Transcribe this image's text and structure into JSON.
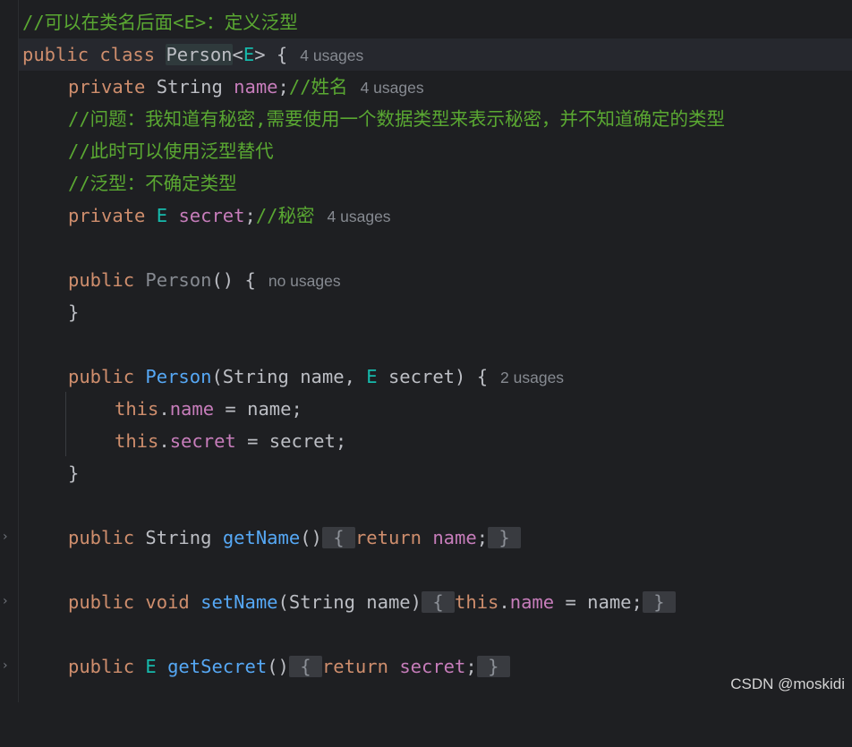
{
  "editor": {
    "l1": {
      "comment": "//可以在类名后面<E>：定义泛型"
    },
    "l2": {
      "kw_public": "public",
      "kw_class": "class",
      "class_name": "Person",
      "lt": "<",
      "type_param": "E",
      "gt_brace": "> {",
      "hint": "4 usages"
    },
    "l3": {
      "kw": "private",
      "type": "String",
      "field": "name",
      "semi": ";",
      "comment": "//姓名",
      "hint": "4 usages"
    },
    "l4": {
      "comment": "//问题：我知道有秘密,需要使用一个数据类型来表示秘密，并不知道确定的类型"
    },
    "l5": {
      "comment": "//此时可以使用泛型替代"
    },
    "l6": {
      "comment": "//泛型：不确定类型"
    },
    "l7": {
      "kw": "private",
      "type": "E",
      "field": "secret",
      "semi": ";",
      "comment": "//秘密",
      "hint": "4 usages"
    },
    "l9": {
      "kw": "public",
      "name": "Person",
      "rest": "() {",
      "hint": "no usages"
    },
    "l10": {
      "text": "}"
    },
    "l12": {
      "kw": "public",
      "name": "Person",
      "p1": "(String name, ",
      "type": "E",
      "p2": " secret) {",
      "hint": "2 usages"
    },
    "l13": {
      "kw_this": "this",
      "dot": ".",
      "field": "name",
      "rest": " = name;"
    },
    "l14": {
      "kw_this": "this",
      "dot": ".",
      "field": "secret",
      "rest": " = secret;"
    },
    "l15": {
      "text": "}"
    },
    "l17": {
      "kw": "public",
      "type": "String",
      "fn": "getName",
      "paren": "()",
      "open": "{",
      "ret": "return",
      "field": "name",
      "semi": ";",
      "close": "}"
    },
    "l19": {
      "kw": "public",
      "kw_void": "void",
      "fn": "setName",
      "params": "(String name)",
      "open": "{",
      "kw_this": "this",
      "dot": ".",
      "field": "name",
      "rest": " = name;",
      "close": "}"
    },
    "l21": {
      "kw": "public",
      "type": "E",
      "fn": "getSecret",
      "paren": "()",
      "open": "{",
      "ret": "return",
      "field": "secret",
      "semi": ";",
      "close": "}"
    }
  },
  "gutter": {
    "fold_icon": "chevron-right-icon",
    "fold_glyph": "›"
  },
  "watermark": "CSDN @moskidi"
}
